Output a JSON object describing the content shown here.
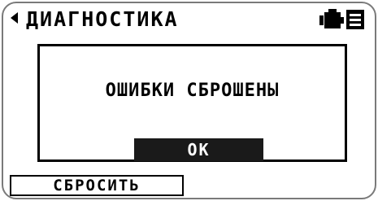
{
  "header": {
    "title": "ДИАГНОСТИКА",
    "back_icon": "left-triangle-icon",
    "status_icon": "vehicle-device-icon"
  },
  "dialog": {
    "message": "ОШИБКИ СБРОШЕНЫ",
    "ok_label": "ОК"
  },
  "softkeys": {
    "left_label": "СБРОСИТЬ"
  },
  "colors": {
    "background": "#ffffff",
    "foreground": "#000000",
    "button_fill": "#1a1a1a",
    "bezel": "#7a7a7a"
  }
}
